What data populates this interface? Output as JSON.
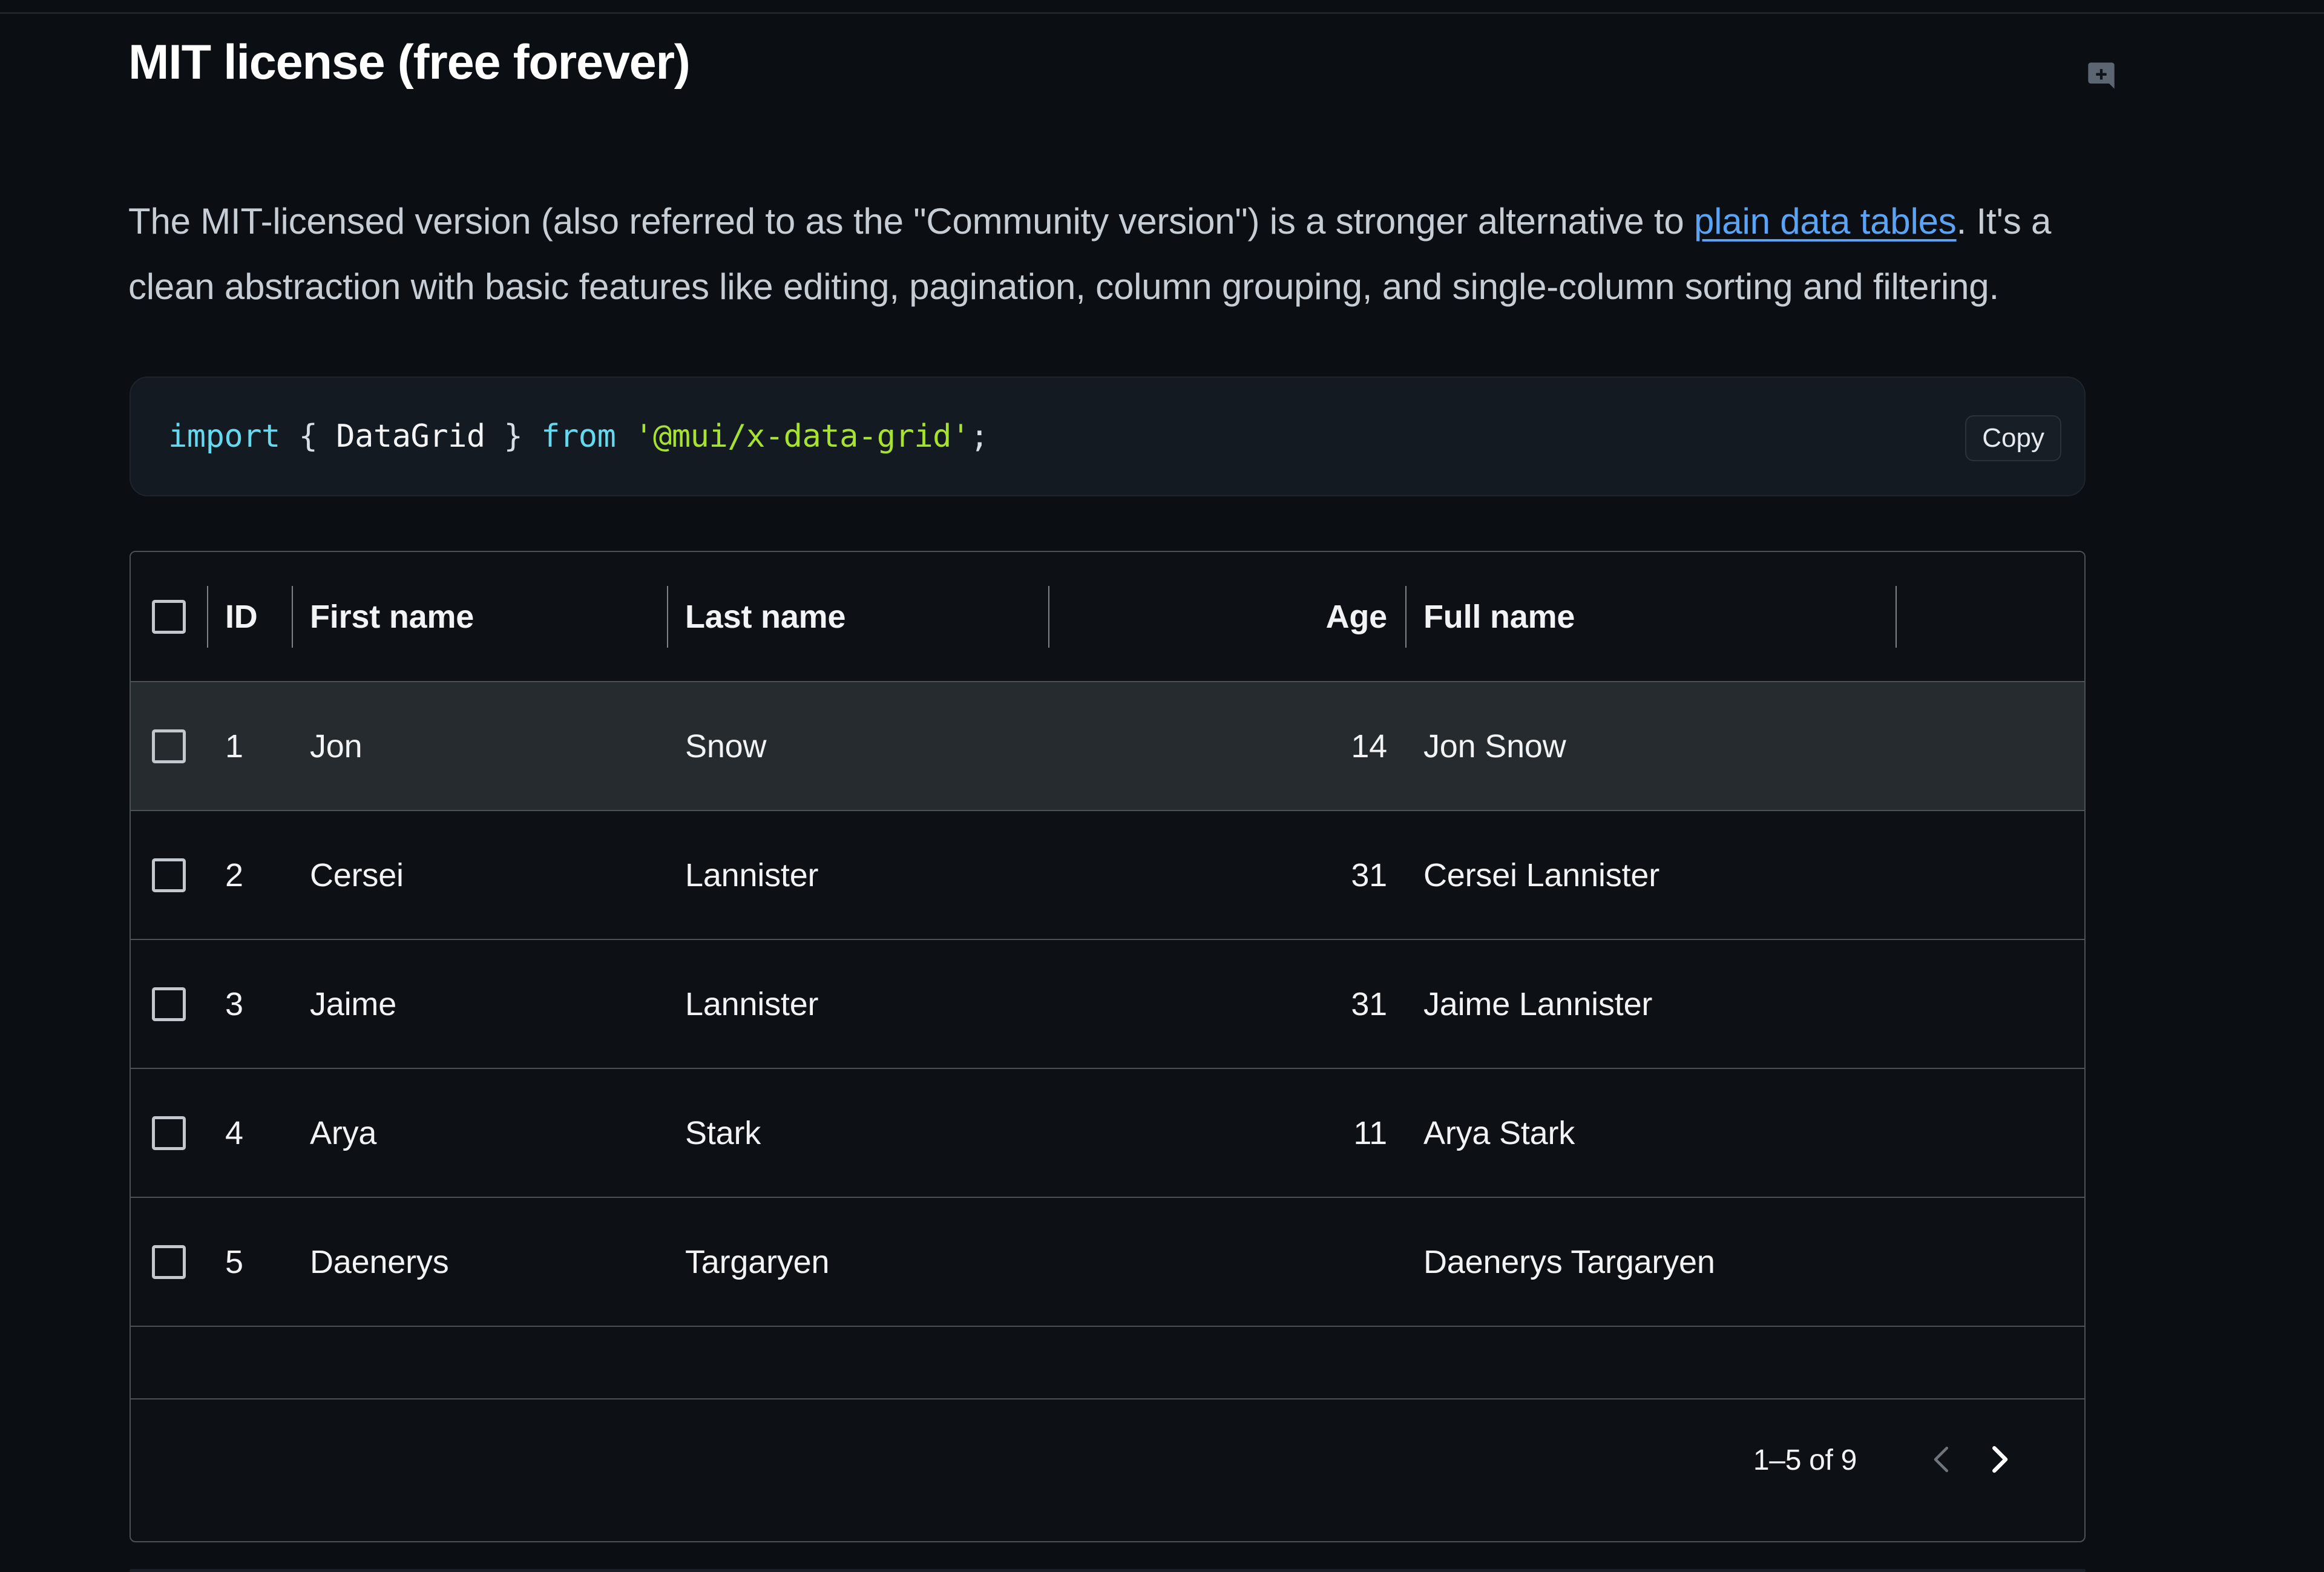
{
  "header": {
    "title": "MIT license (free forever)",
    "comment_icon": "add-comment-icon"
  },
  "intro": {
    "part1": "The MIT-licensed version (also referred to as the \"Community version\") is a stronger alternative to ",
    "link_text": "plain data tables",
    "part2": ". It's a clean abstraction with basic features like editing, pagination, column grouping, and single-column sorting and filtering."
  },
  "code": {
    "tokens": [
      {
        "text": "import",
        "kind": "kw"
      },
      {
        "text": " ",
        "kind": "pun"
      },
      {
        "text": "{",
        "kind": "pun"
      },
      {
        "text": " ",
        "kind": "pun"
      },
      {
        "text": "DataGrid",
        "kind": "id"
      },
      {
        "text": " ",
        "kind": "pun"
      },
      {
        "text": "}",
        "kind": "pun"
      },
      {
        "text": " ",
        "kind": "pun"
      },
      {
        "text": "from",
        "kind": "kw"
      },
      {
        "text": " ",
        "kind": "pun"
      },
      {
        "text": "'@mui/x-data-grid'",
        "kind": "str"
      },
      {
        "text": ";",
        "kind": "pun"
      }
    ],
    "plain": "import { DataGrid } from '@mui/x-data-grid';",
    "copy_label": "Copy"
  },
  "grid": {
    "columns": [
      {
        "field": "id",
        "label": "ID",
        "align": "left"
      },
      {
        "field": "first",
        "label": "First name",
        "align": "left"
      },
      {
        "field": "last",
        "label": "Last name",
        "align": "left"
      },
      {
        "field": "age",
        "label": "Age",
        "align": "right"
      },
      {
        "field": "full",
        "label": "Full name",
        "align": "left"
      }
    ],
    "rows": [
      {
        "id": "1",
        "first": "Jon",
        "last": "Snow",
        "age": "14",
        "full": "Jon Snow",
        "hovered": true,
        "checked": false
      },
      {
        "id": "2",
        "first": "Cersei",
        "last": "Lannister",
        "age": "31",
        "full": "Cersei Lannister",
        "hovered": false,
        "checked": false
      },
      {
        "id": "3",
        "first": "Jaime",
        "last": "Lannister",
        "age": "31",
        "full": "Jaime Lannister",
        "hovered": false,
        "checked": false
      },
      {
        "id": "4",
        "first": "Arya",
        "last": "Stark",
        "age": "11",
        "full": "Arya Stark",
        "hovered": false,
        "checked": false
      },
      {
        "id": "5",
        "first": "Daenerys",
        "last": "Targaryen",
        "age": "",
        "full": "Daenerys Targaryen",
        "hovered": false,
        "checked": false
      }
    ],
    "select_all_checked": false,
    "footer": {
      "range_label": "1–5 of 9",
      "prev_icon": "chevron-left-icon",
      "next_icon": "chevron-right-icon",
      "prev_disabled": true,
      "next_disabled": false
    }
  },
  "colors": {
    "page_bg": "#0B0F14",
    "link": "#5BA3F5",
    "code_bg": "#141A22",
    "grid_border": "#4A5157",
    "row_hover": "#252B2F",
    "token_keyword": "#66D9EF",
    "token_string": "#A6E22E"
  }
}
